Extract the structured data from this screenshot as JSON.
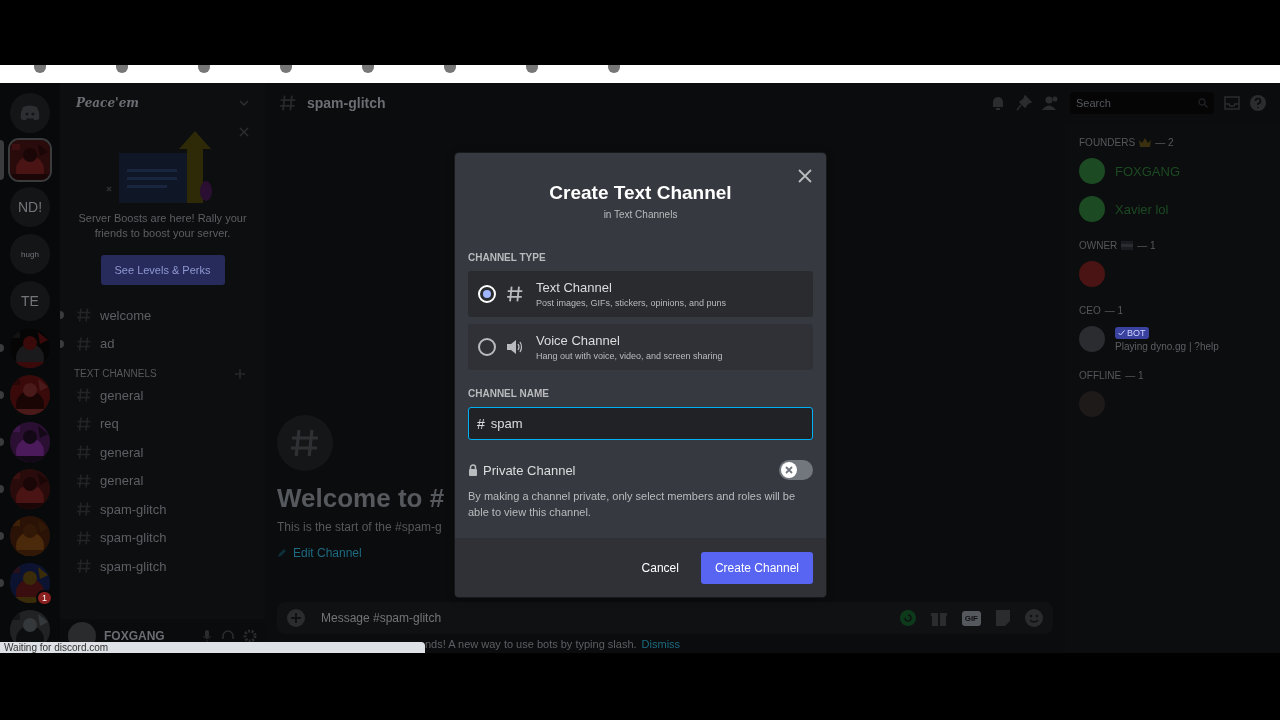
{
  "browser": {
    "status": "Waiting for discord.com"
  },
  "servers": [
    {
      "kind": "logo",
      "selected": false,
      "unread": false
    },
    {
      "kind": "picture",
      "selected": true,
      "unread": false
    },
    {
      "kind": "initials",
      "label": "ND!",
      "selected": false,
      "unread": false
    },
    {
      "kind": "initials",
      "label": "hugh",
      "selected": false,
      "unread": false
    },
    {
      "kind": "initials",
      "label": "TE",
      "selected": false,
      "unread": false
    },
    {
      "kind": "picture",
      "selected": false,
      "unread": true
    },
    {
      "kind": "picture",
      "selected": false,
      "unread": true
    },
    {
      "kind": "picture",
      "selected": false,
      "unread": true
    },
    {
      "kind": "picture",
      "selected": false,
      "unread": true
    },
    {
      "kind": "picture",
      "selected": false,
      "unread": true
    },
    {
      "kind": "picture",
      "selected": false,
      "unread": true,
      "badge": "1"
    },
    {
      "kind": "picture",
      "selected": false,
      "unread": false
    }
  ],
  "server": {
    "name": "Peace'em"
  },
  "boost": {
    "text": "Server Boosts are here! Rally your friends to boost your server.",
    "button": "See Levels & Perks"
  },
  "channels": [
    {
      "name": "welcome",
      "unread": true
    },
    {
      "name": "ad",
      "unread": true
    }
  ],
  "categories": [
    {
      "name": "TEXT CHANNELS",
      "channels": [
        {
          "name": "general",
          "unread": false
        },
        {
          "name": "req",
          "unread": false
        },
        {
          "name": "general",
          "unread": false
        },
        {
          "name": "general",
          "unread": false
        },
        {
          "name": "spam-glitch",
          "unread": false
        },
        {
          "name": "spam-glitch",
          "unread": false
        },
        {
          "name": "spam-glitch",
          "unread": false
        }
      ]
    }
  ],
  "user": {
    "name": "FOXGANG"
  },
  "chat": {
    "channel": "spam-glitch",
    "search_placeholder": "Search",
    "welcome_title": "Welcome to #",
    "welcome_text": "This is the start of the #spam-g",
    "edit_link": "Edit Channel",
    "message_placeholder": "Message #spam-glitch",
    "gif_label": "GIF",
    "notice_text": "nds! A new way to use bots by typing slash.",
    "notice_link": "Dismiss"
  },
  "members": [
    {
      "title": "FOUNDERS",
      "kind": "crown",
      "count": "— 2",
      "people": [
        {
          "name": "FOXGANG",
          "color": "#1c4a22"
        },
        {
          "name": "Xavier lol",
          "color": "#1c4a22"
        }
      ]
    },
    {
      "title": "OWNER",
      "kind": "flag",
      "count": "— 1",
      "people": [
        {
          "color": "#4a1414"
        }
      ]
    },
    {
      "title": "CEO",
      "count": "— 1",
      "people": [
        {
          "tag": "BOT",
          "status": "Playing dyno.gg | ?help",
          "color": "#2a2c30"
        }
      ]
    },
    {
      "title": "OFFLINE",
      "count": "— 1",
      "people": [
        {
          "color": "#1e1a1a"
        }
      ]
    }
  ],
  "modal": {
    "title": "Create Text Channel",
    "subtitle": "in Text Channels",
    "type_label": "CHANNEL TYPE",
    "options": [
      {
        "kind": "text",
        "name": "Text Channel",
        "description": "Post images, GIFs, stickers, opinions, and puns",
        "selected": true
      },
      {
        "kind": "voice",
        "name": "Voice Channel",
        "description": "Hang out with voice, video, and screen sharing",
        "selected": false
      }
    ],
    "name_label": "CHANNEL NAME",
    "name_prefix": "#",
    "name_value": "spam",
    "private": {
      "label": "Private Channel",
      "on": false,
      "description": "By making a channel private, only select members and roles will be able to view this channel."
    },
    "cancel": "Cancel",
    "create": "Create Channel"
  }
}
